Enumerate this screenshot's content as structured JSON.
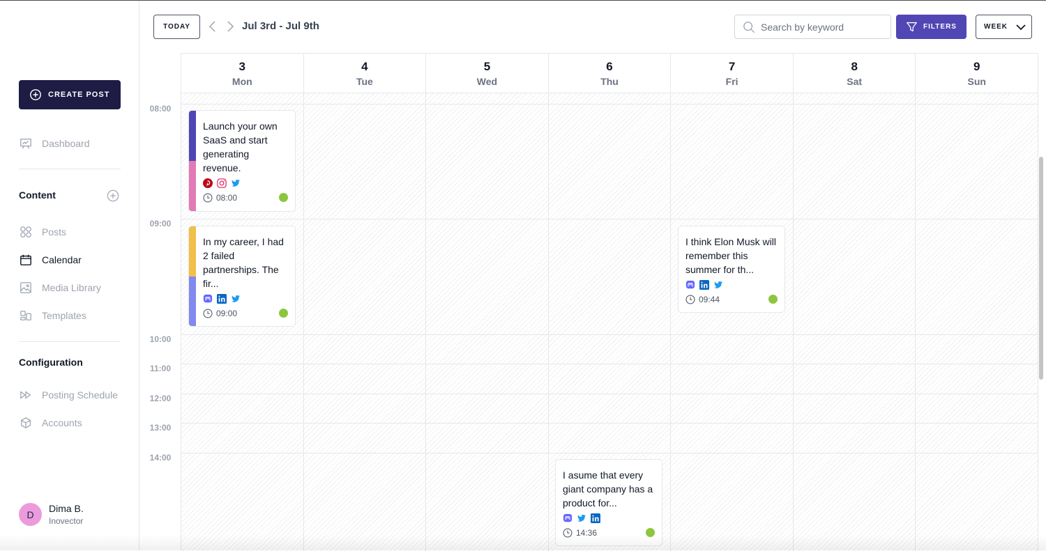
{
  "sidebar": {
    "create_post_label": "CREATE POST",
    "dashboard": "Dashboard",
    "content_title": "Content",
    "content_items": [
      {
        "label": "Posts",
        "icon": "grid-icon",
        "active": false
      },
      {
        "label": "Calendar",
        "icon": "calendar-icon",
        "active": true
      },
      {
        "label": "Media Library",
        "icon": "image-icon",
        "active": false
      },
      {
        "label": "Templates",
        "icon": "templates-icon",
        "active": false
      }
    ],
    "configuration_title": "Configuration",
    "configuration_items": [
      {
        "label": "Posting Schedule",
        "icon": "fast-forward-icon"
      },
      {
        "label": "Accounts",
        "icon": "cube-icon"
      }
    ],
    "user": {
      "initial": "D",
      "name": "Dima B.",
      "org": "Inovector"
    }
  },
  "toolbar": {
    "today_label": "TODAY",
    "date_range": "Jul 3rd - Jul 9th",
    "search_placeholder": "Search by keyword",
    "search_value": "",
    "filters_label": "FILTERS",
    "view_selected": "WEEK"
  },
  "calendar": {
    "days": [
      {
        "num": "3",
        "name": "Mon"
      },
      {
        "num": "4",
        "name": "Tue"
      },
      {
        "num": "5",
        "name": "Wed"
      },
      {
        "num": "6",
        "name": "Thu"
      },
      {
        "num": "7",
        "name": "Fri"
      },
      {
        "num": "8",
        "name": "Sat"
      },
      {
        "num": "9",
        "name": "Sun"
      }
    ],
    "times": [
      "08:00",
      "09:00",
      "10:00",
      "11:00",
      "12:00",
      "13:00",
      "14:00"
    ],
    "posts": [
      {
        "text": "Launch your own SaaS and start generating revenue.",
        "time": "08:00",
        "day": "Mon",
        "networks": [
          "pinterest",
          "instagram",
          "twitter"
        ],
        "bar_colors": [
          "#4f46b4",
          "#e27ab5"
        ],
        "status": "published",
        "status_color": "#8cc63f"
      },
      {
        "text": "In my career, I had 2 failed partnerships. The fir...",
        "time": "09:00",
        "day": "Mon",
        "networks": [
          "mastodon",
          "linkedin",
          "twitter"
        ],
        "bar_colors": [
          "#f2bf4a",
          "#8189ee"
        ],
        "status": "published",
        "status_color": "#8cc63f"
      },
      {
        "text": "I think Elon Musk will remember this summer for th...",
        "time": "09:44",
        "day": "Fri",
        "networks": [
          "mastodon",
          "linkedin",
          "twitter"
        ],
        "bar_colors": [],
        "status": "published",
        "status_color": "#8cc63f"
      },
      {
        "text": "I asume that every giant company has a product for...",
        "time": "14:36",
        "day": "Thu",
        "networks": [
          "mastodon",
          "twitter",
          "linkedin"
        ],
        "bar_colors": [],
        "status": "published",
        "status_color": "#8cc63f"
      }
    ]
  },
  "colors": {
    "primary_dark": "#1e1b45",
    "accent": "#5046b4",
    "status_green": "#8cc63f",
    "pinterest": "#bd081c",
    "instagram": "#e1306c",
    "twitter": "#1d9bf0",
    "linkedin": "#0a66c2",
    "mastodon": "#6364ff"
  }
}
